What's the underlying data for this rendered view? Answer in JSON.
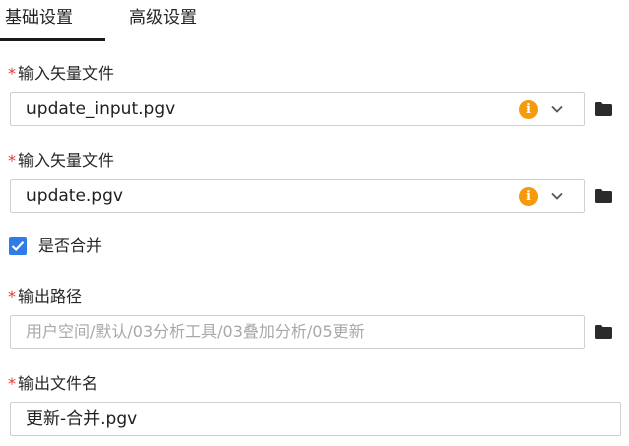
{
  "tabs": {
    "basic": "基础设置",
    "advanced": "高级设置"
  },
  "form": {
    "required_mark": "*",
    "input_vector_1": {
      "label": "输入矢量文件",
      "value": "update_input.pgv",
      "info_icon": "i"
    },
    "input_vector_2": {
      "label": "输入矢量文件",
      "value": "update.pgv",
      "info_icon": "i"
    },
    "merge": {
      "label": "是否合并",
      "checked": true
    },
    "output_path": {
      "label": "输出路径",
      "placeholder": "用户空间/默认/03分析工具/03叠加分析/05更新"
    },
    "output_filename": {
      "label": "输出文件名",
      "value": "更新-合并.pgv"
    }
  },
  "colors": {
    "required": "#e53935",
    "info": "#f59a0b",
    "checkbox": "#2f7be8",
    "tab_indicator": "#1a1a1a"
  },
  "icons": [
    "info-icon",
    "chevron-down-icon",
    "folder-icon",
    "checkbox-check-icon"
  ]
}
